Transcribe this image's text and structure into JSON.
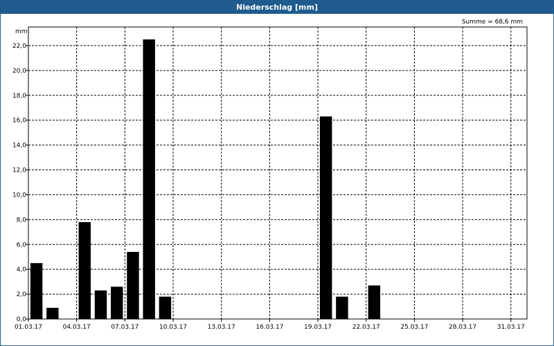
{
  "window": {
    "title": "Niederschlag [mm]"
  },
  "chart_data": {
    "type": "bar",
    "ylabel": "mm",
    "summary": "Summe = 68,6 mm",
    "ylim": [
      0,
      23.5
    ],
    "yticks": [
      0,
      2,
      4,
      6,
      8,
      10,
      12,
      14,
      16,
      18,
      20,
      22
    ],
    "ytick_labels": [
      "0,0",
      "2,0",
      "4,0",
      "6,0",
      "8,0",
      "10,0",
      "12,0",
      "14,0",
      "16,0",
      "18,0",
      "20,0",
      "22,0"
    ],
    "xtick_labels": [
      "01.03.17",
      "04.03.17",
      "07.03.17",
      "10.03.17",
      "13.03.17",
      "16.03.17",
      "19.03.17",
      "22.03.17",
      "25.03.17",
      "28.03.17",
      "31.03.17"
    ],
    "categories": [
      "01.03.17",
      "02.03.17",
      "03.03.17",
      "04.03.17",
      "05.03.17",
      "06.03.17",
      "07.03.17",
      "08.03.17",
      "09.03.17",
      "10.03.17",
      "11.03.17",
      "12.03.17",
      "13.03.17",
      "14.03.17",
      "15.03.17",
      "16.03.17",
      "17.03.17",
      "18.03.17",
      "19.03.17",
      "20.03.17",
      "21.03.17",
      "22.03.17",
      "23.03.17",
      "24.03.17",
      "25.03.17",
      "26.03.17",
      "27.03.17",
      "28.03.17",
      "29.03.17",
      "30.03.17",
      "31.03.17"
    ],
    "values": [
      4.5,
      0.9,
      0,
      7.8,
      2.3,
      2.6,
      5.4,
      22.5,
      1.8,
      0,
      0,
      0,
      0,
      0,
      0,
      0,
      0,
      0,
      16.3,
      1.8,
      0,
      2.7,
      0,
      0,
      0,
      0,
      0,
      0,
      0,
      0,
      0
    ],
    "grid": true,
    "bar_color": "#000000"
  }
}
